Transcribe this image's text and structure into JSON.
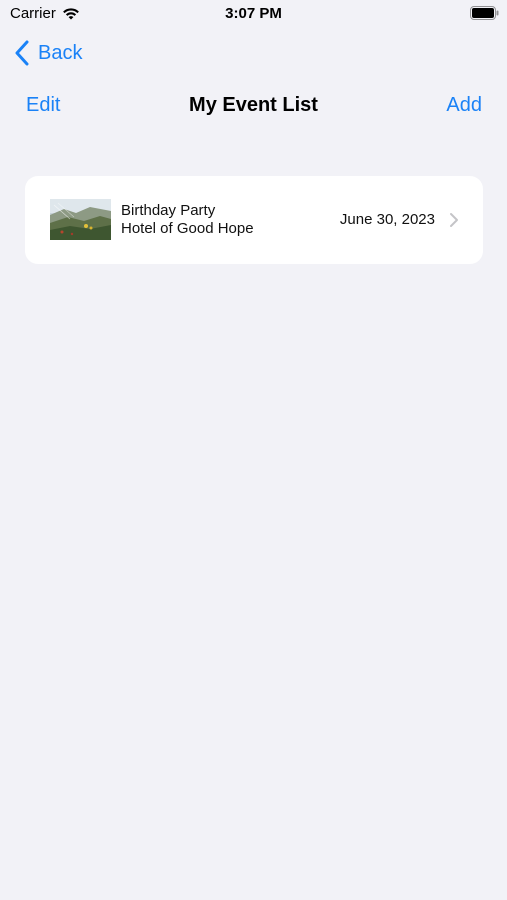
{
  "status_bar": {
    "carrier": "Carrier",
    "time": "3:07 PM"
  },
  "nav": {
    "back_label": "Back",
    "edit_label": "Edit",
    "title": "My Event List",
    "add_label": "Add"
  },
  "events": [
    {
      "name": "Birthday Party",
      "location": "Hotel of Good Hope",
      "date": "June 30, 2023",
      "thumbnail": "landscape-photo"
    }
  ],
  "colors": {
    "accent": "#1a82f7",
    "background": "#f2f2f7",
    "card": "#ffffff"
  },
  "icons": {
    "wifi": "wifi-icon",
    "battery": "battery-icon",
    "back": "chevron-left-icon",
    "disclosure": "chevron-right-icon"
  }
}
